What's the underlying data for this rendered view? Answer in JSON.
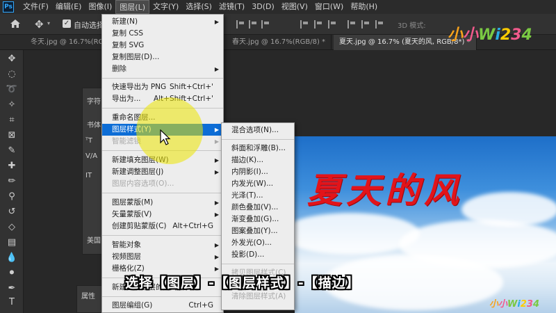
{
  "app": {
    "logo_text": "Ps"
  },
  "menubar": {
    "items": [
      {
        "label": "文件(F)"
      },
      {
        "label": "编辑(E)"
      },
      {
        "label": "图像(I)"
      },
      {
        "label": "图层(L)"
      },
      {
        "label": "文字(Y)"
      },
      {
        "label": "选择(S)"
      },
      {
        "label": "滤镜(T)"
      },
      {
        "label": "3D(D)"
      },
      {
        "label": "视图(V)"
      },
      {
        "label": "窗口(W)"
      },
      {
        "label": "帮助(H)"
      }
    ],
    "active_index": 3
  },
  "options_bar": {
    "auto_select_label": "自动选择",
    "mode_3d_label": "3D 模式:"
  },
  "tabs": [
    {
      "label": "冬天.jpg @ 16.7%(RGB/8) *"
    },
    {
      "label": "春天.jpg @ 16.7%(RGB/8) *"
    },
    {
      "label": "夏天.jpg @ 16.7% (夏天的风, RGB/8*) *"
    }
  ],
  "panels": {
    "char_tab": "字符",
    "font_label": "书体",
    "props_tab": "属性",
    "lang_label": "美国"
  },
  "layer_menu": {
    "items": [
      {
        "label": "新建(N)",
        "submenu": true
      },
      {
        "label": "复制 CSS"
      },
      {
        "label": "复制 SVG"
      },
      {
        "label": "复制图层(D)..."
      },
      {
        "label": "删除",
        "submenu": true
      },
      {
        "sep": true
      },
      {
        "label": "快速导出为 PNG",
        "shortcut": "Shift+Ctrl+'"
      },
      {
        "label": "导出为...",
        "shortcut": "Alt+Shift+Ctrl+'"
      },
      {
        "sep": true
      },
      {
        "label": "重命名图层..."
      },
      {
        "label": "图层样式(Y)",
        "submenu": true,
        "highlighted": true
      },
      {
        "label": "智能滤镜",
        "submenu": true,
        "disabled": true
      },
      {
        "sep": true
      },
      {
        "label": "新建填充图层(W)",
        "submenu": true
      },
      {
        "label": "新建调整图层(J)",
        "submenu": true
      },
      {
        "label": "图层内容选项(O)...",
        "disabled": true
      },
      {
        "sep": true
      },
      {
        "label": "图层蒙版(M)",
        "submenu": true
      },
      {
        "label": "矢量蒙版(V)",
        "submenu": true
      },
      {
        "label": "创建剪贴蒙版(C)",
        "shortcut": "Alt+Ctrl+G"
      },
      {
        "sep": true
      },
      {
        "label": "智能对象",
        "submenu": true
      },
      {
        "label": "视频图层",
        "submenu": true
      },
      {
        "label": "栅格化(Z)",
        "submenu": true
      },
      {
        "sep": true
      },
      {
        "label": "新建基于图层的切片(B)"
      },
      {
        "sep": true
      },
      {
        "label": "图层编组(G)",
        "shortcut": "Ctrl+G"
      }
    ]
  },
  "style_submenu": {
    "items": [
      {
        "label": "混合选项(N)..."
      },
      {
        "sep": true
      },
      {
        "label": "斜面和浮雕(B)..."
      },
      {
        "label": "描边(K)..."
      },
      {
        "label": "内阴影(I)..."
      },
      {
        "label": "内发光(W)..."
      },
      {
        "label": "光泽(T)..."
      },
      {
        "label": "颜色叠加(V)..."
      },
      {
        "label": "渐变叠加(G)..."
      },
      {
        "label": "图案叠加(Y)..."
      },
      {
        "label": "外发光(O)..."
      },
      {
        "label": "投影(D)..."
      },
      {
        "sep": true
      },
      {
        "label": "拷贝图层样式(C)",
        "disabled": true
      },
      {
        "label": "粘贴图层样式(P)",
        "disabled": true
      },
      {
        "label": "清除图层样式(A)",
        "disabled": true
      }
    ]
  },
  "canvas": {
    "title_text": "夏天的风"
  },
  "subtitle": "选择【图层】-【图层样式】-【描边】",
  "watermark": {
    "chars": [
      "小",
      "小",
      "W",
      "i",
      "2",
      "3",
      "4"
    ]
  },
  "colors": {
    "highlight": "#0d6dd6",
    "spotlight": "#ece600",
    "title_red": "#e2141a"
  }
}
